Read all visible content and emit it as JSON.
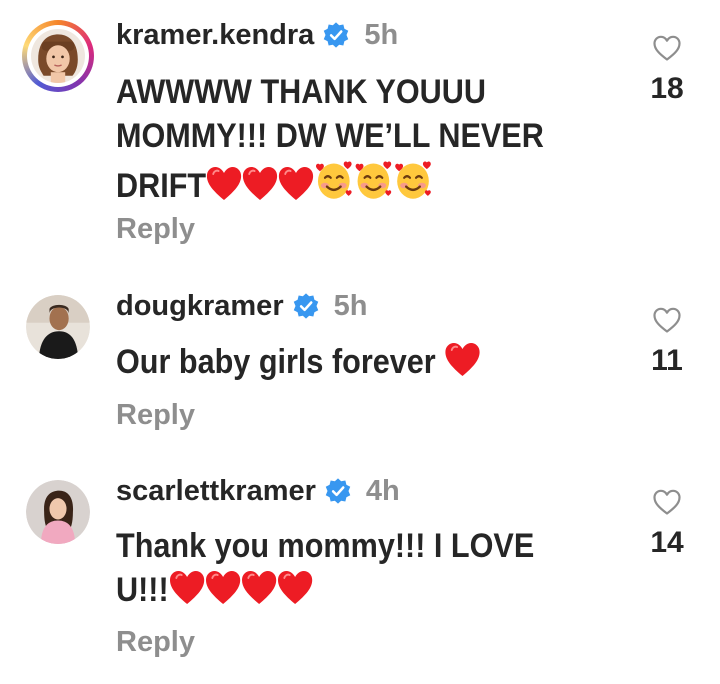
{
  "colors": {
    "verified": "#3897f0",
    "heart": "#ed1c24",
    "muted": "#8e8e8e",
    "text": "#262626"
  },
  "comments": [
    {
      "username": "kramer.kendra",
      "time": "5h",
      "text_lines": [
        "AWWWW THANK YOUUU",
        "MOMMY!!! DW WE’LL NEVER",
        "DRIFT"
      ],
      "trailing_emoji": [
        "red-heart",
        "red-heart",
        "red-heart",
        "smiling-face-with-hearts",
        "smiling-face-with-hearts",
        "smiling-face-with-hearts"
      ],
      "likes": "18",
      "reply_label": "Reply",
      "story_ring": true
    },
    {
      "username": "dougkramer",
      "time": "5h",
      "text_lines": [
        "Our baby girls forever"
      ],
      "trailing_emoji": [
        "red-heart"
      ],
      "likes": "11",
      "reply_label": "Reply",
      "story_ring": false
    },
    {
      "username": "scarlettkramer",
      "time": "4h",
      "text_lines": [
        "Thank you mommy!!! I LOVE",
        "U!!!"
      ],
      "trailing_emoji": [
        "red-heart",
        "red-heart",
        "red-heart",
        "red-heart"
      ],
      "likes": "14",
      "reply_label": "Reply",
      "story_ring": false
    }
  ]
}
